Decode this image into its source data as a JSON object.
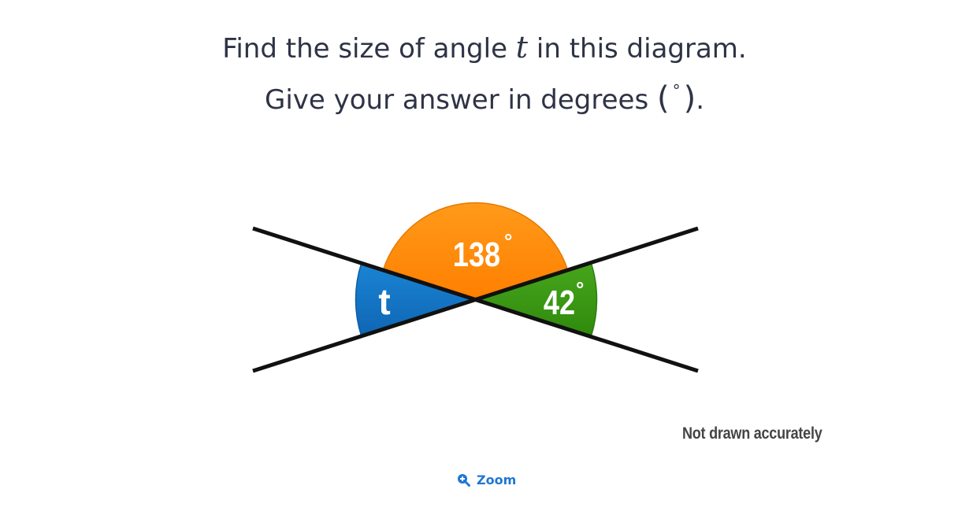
{
  "question": {
    "line1_pre": "Find the size of angle ",
    "variable": "t",
    "line1_post": " in this diagram.",
    "line2_pre": "Give your answer in degrees ",
    "paren_open": "(",
    "degree_symbol": "°",
    "paren_close": ")",
    "line2_post": "."
  },
  "diagram": {
    "angles": [
      {
        "label": "138",
        "degree": "°",
        "color": "#ff8c00"
      },
      {
        "label": "42",
        "degree": "°",
        "color": "#3a9a13"
      },
      {
        "label": "t",
        "degree": "",
        "color": "#1576c7"
      }
    ],
    "line_color": "#111111"
  },
  "note": "Not drawn accurately",
  "zoom": {
    "label": "Zoom",
    "icon": "zoom-in-icon"
  }
}
